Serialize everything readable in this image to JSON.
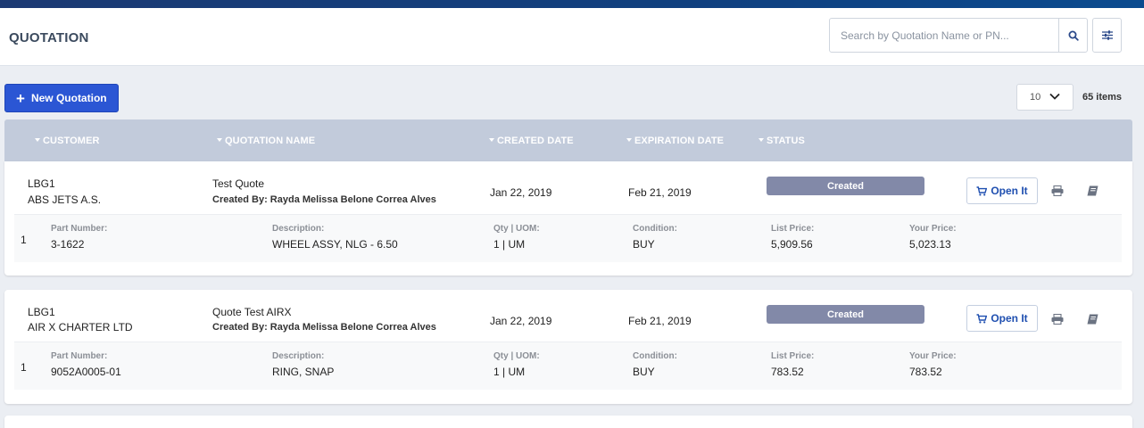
{
  "header": {
    "title": "QUOTATION",
    "search_placeholder": "Search by Quotation Name or PN...",
    "search_value": ""
  },
  "toolbar": {
    "new_label": "New Quotation",
    "per_page": "10",
    "items_count": "65 items"
  },
  "columns": [
    "CUSTOMER",
    "QUOTATION NAME",
    "CREATED DATE",
    "EXPIRATION DATE",
    "STATUS"
  ],
  "labels": {
    "part_number": "Part Number:",
    "description": "Description:",
    "qty_uom": "Qty | UOM:",
    "condition": "Condition:",
    "list_price": "List Price:",
    "your_price": "Your Price:",
    "open": "Open It"
  },
  "quotes": [
    {
      "customer_code": "LBG1",
      "customer_name": "ABS JETS A.S.",
      "quote_name": "Test Quote",
      "created_by": "Created By: Rayda Melissa Belone Correa Alves",
      "created_date": "Jan 22, 2019",
      "expiration_date": "Feb 21, 2019",
      "status": "Created",
      "line": {
        "number": "1",
        "part_number": "3-1622",
        "description": "WHEEL ASSY, NLG - 6.50",
        "qty_uom": "1 | UM",
        "condition": "BUY",
        "list_price": "5,909.56",
        "your_price": "5,023.13"
      }
    },
    {
      "customer_code": "LBG1",
      "customer_name": "AIR X CHARTER LTD",
      "quote_name": "Quote Test AIRX",
      "created_by": "Created By: Rayda Melissa Belone Correa Alves",
      "created_date": "Jan 22, 2019",
      "expiration_date": "Feb 21, 2019",
      "status": "Created",
      "line": {
        "number": "1",
        "part_number": "9052A0005-01",
        "description": "RING, SNAP",
        "qty_uom": "1 | UM",
        "condition": "BUY",
        "list_price": "783.52",
        "your_price": "783.52"
      }
    }
  ],
  "colors": {
    "accent": "#2b56d4",
    "status_created": "#8289a8",
    "table_header": "#c2cbdb",
    "topbar": "#10407f"
  },
  "icons": [
    "search-icon",
    "filter-sliders-icon",
    "plus-icon",
    "chevron-down-icon",
    "cart-icon",
    "print-icon",
    "book-icon"
  ]
}
